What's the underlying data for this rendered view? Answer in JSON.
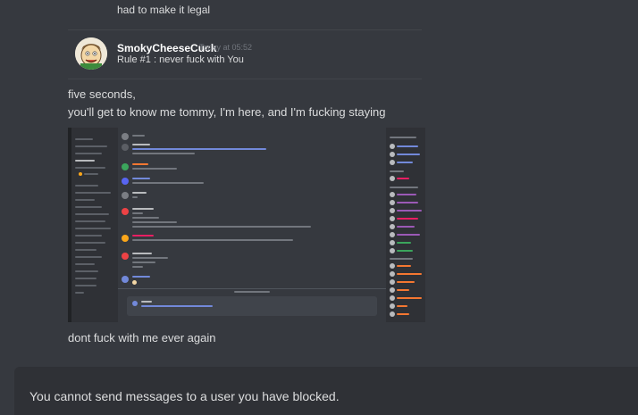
{
  "messages": {
    "prev_line": "had to make it legal",
    "author": "SmokyCheeseCuck",
    "timestamp": "Today at 05:52",
    "rule_line": "Rule #1 : never fuck with You",
    "line1": "five seconds,",
    "line2": "you'll get to know me tommy, I'm here, and I'm fucking staying",
    "line3": "dont fuck with me ever again"
  },
  "composer": {
    "blocked_notice": "You cannot send messages to a user you have blocked."
  },
  "colors": {
    "background": "#36393f",
    "panel": "#2f3136",
    "accent": "#7289da"
  }
}
